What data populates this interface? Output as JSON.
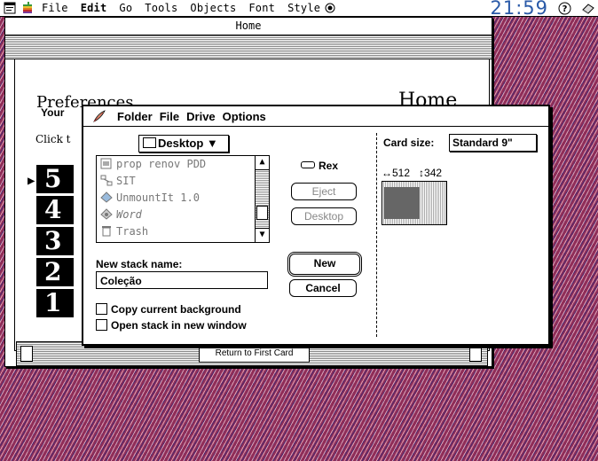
{
  "menubar": {
    "items": [
      "File",
      "Edit",
      "Go",
      "Tools",
      "Objects",
      "Font",
      "Style"
    ],
    "clock": "21:59"
  },
  "hypercard": {
    "window_title": "Home",
    "card_title_left": "Preferences",
    "card_title_right": "Home",
    "your_label": "Your",
    "click_label": "Click t",
    "levels": [
      "5",
      "4",
      "3",
      "2",
      "1"
    ],
    "return_button": "Return to First Card"
  },
  "dialog": {
    "menu": [
      "Folder",
      "File",
      "Drive",
      "Options"
    ],
    "folder_popup": "Desktop",
    "files": [
      {
        "name": "prop renov PDD",
        "icon": "stack-icon",
        "italic": false
      },
      {
        "name": "SIT",
        "icon": "network-icon",
        "italic": false
      },
      {
        "name": "UnmountIt 1.0",
        "icon": "app-icon",
        "italic": false
      },
      {
        "name": "Word",
        "icon": "word-icon",
        "italic": true
      },
      {
        "name": "Trash",
        "icon": "trash-icon",
        "italic": false
      }
    ],
    "volume": "Rex",
    "eject_button": "Eject",
    "desktop_button": "Desktop",
    "new_button": "New",
    "cancel_button": "Cancel",
    "card_size_label": "Card size:",
    "card_size_value": "Standard 9\"",
    "width_label": "↔512",
    "height_label": "↕342",
    "name_label": "New stack name:",
    "name_value": "Coleção",
    "copy_background": "Copy current background",
    "open_new_window": "Open stack in new window"
  }
}
